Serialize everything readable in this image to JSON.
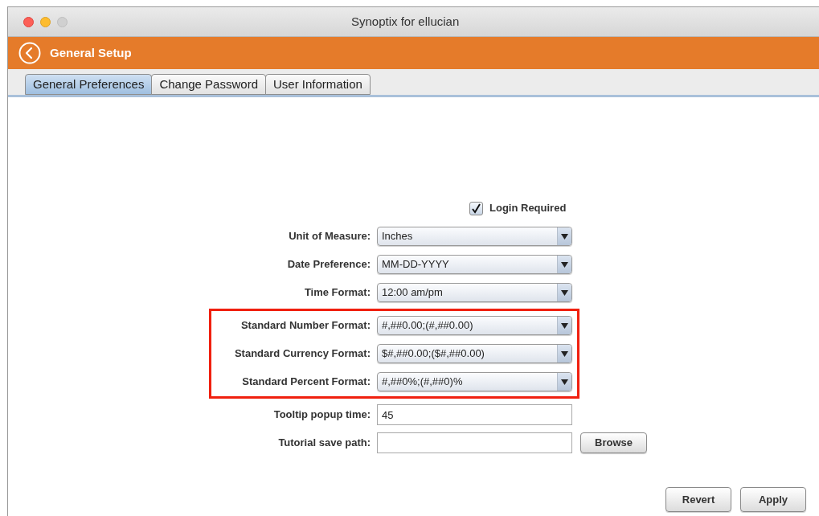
{
  "window": {
    "title": "Synoptix for ellucian"
  },
  "header": {
    "title": "General Setup"
  },
  "tabs": [
    {
      "label": "General Preferences",
      "selected": true
    },
    {
      "label": "Change Password",
      "selected": false
    },
    {
      "label": "User Information",
      "selected": false
    }
  ],
  "login_required": {
    "label": "Login Required",
    "checked": true
  },
  "groups": [
    {
      "highlighted": false,
      "rows": [
        {
          "kind": "dropdown",
          "label": "Unit of Measure:",
          "value": "Inches"
        },
        {
          "kind": "dropdown",
          "label": "Date Preference:",
          "value": "MM-DD-YYYY"
        },
        {
          "kind": "dropdown",
          "label": "Time Format:",
          "value": "12:00 am/pm"
        }
      ]
    },
    {
      "highlighted": true,
      "rows": [
        {
          "kind": "dropdown",
          "label": "Standard Number Format:",
          "value": "#,##0.00;(#,##0.00)"
        },
        {
          "kind": "dropdown",
          "label": "Standard Currency Format:",
          "value": "$#,##0.00;($#,##0.00)"
        },
        {
          "kind": "dropdown",
          "label": "Standard Percent Format:",
          "value": "#,##0%;(#,##0)%"
        }
      ]
    },
    {
      "highlighted": false,
      "rows": [
        {
          "kind": "text",
          "label": "Tooltip popup time:",
          "value": "45"
        },
        {
          "kind": "browse",
          "label": "Tutorial save path:",
          "button": "Browse"
        }
      ]
    }
  ],
  "buttons": [
    "Revert",
    "Apply"
  ]
}
